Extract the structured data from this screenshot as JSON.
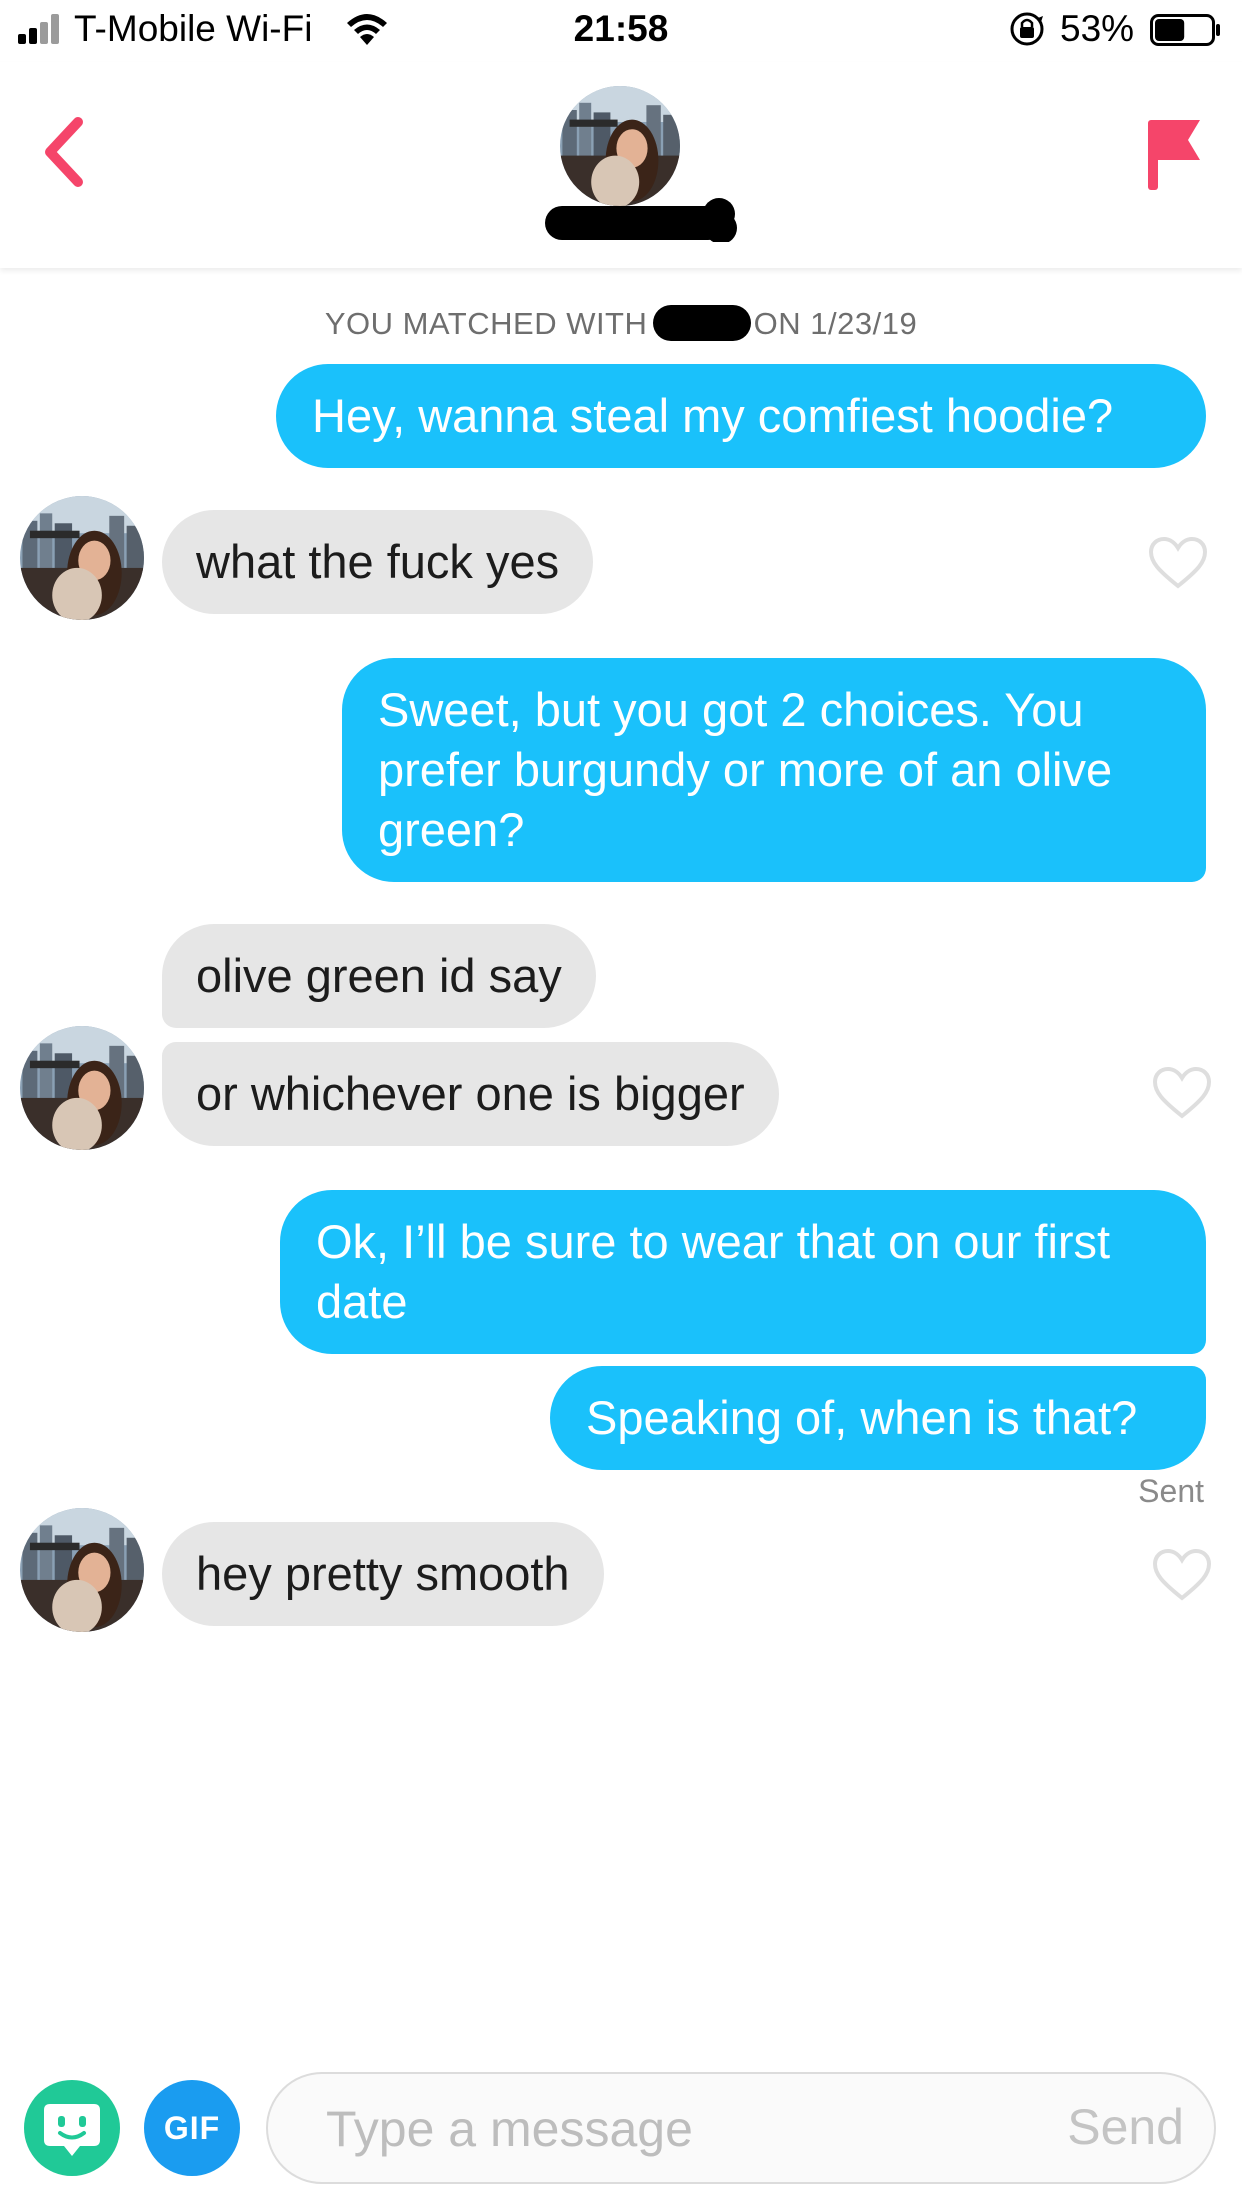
{
  "status_bar": {
    "carrier": "T-Mobile Wi-Fi",
    "time": "21:58",
    "battery": "53%",
    "battery_level": 0.53
  },
  "header": {
    "back_icon": "chevron-left-icon",
    "report_icon": "flag-icon",
    "accent_color": "#f5456a"
  },
  "match_notice": {
    "prefix": "YOU MATCHED WITH",
    "suffix": "ON 1/23/19"
  },
  "messages": [
    {
      "from": "me",
      "text": "Hey, wanna steal my comfiest hoodie?"
    },
    {
      "from": "them",
      "text": "what the fuck yes"
    },
    {
      "from": "me",
      "text": "Sweet, but you got 2 choices. You prefer burgundy or more of an olive green?"
    },
    {
      "from": "them",
      "text": "olive green id say"
    },
    {
      "from": "them",
      "text": "or whichever one is bigger"
    },
    {
      "from": "me",
      "text": "Ok, I’ll be sure to wear that on our first date"
    },
    {
      "from": "me",
      "text": "Speaking of, when is that?"
    },
    {
      "from": "them",
      "text": "hey pretty smooth"
    }
  ],
  "sent_label": "Sent",
  "composer": {
    "gif_label": "GIF",
    "placeholder": "Type a message",
    "send_label": "Send"
  },
  "colors": {
    "outgoing_bubble": "#1ac1fb",
    "incoming_bubble": "#e6e6e6",
    "sticker_button": "#20c997",
    "gif_button": "#1a9cf0"
  }
}
